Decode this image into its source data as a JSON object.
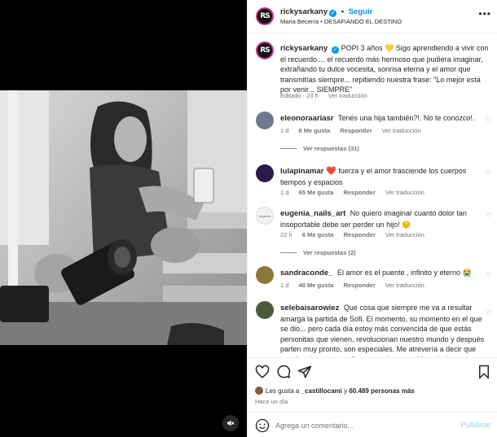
{
  "post": {
    "username": "rickysarkany",
    "follow_label": "Seguir",
    "audio": "Maria Becerra • DESAFIANDO EL DESTINO",
    "avatar_initials": "RS",
    "more_icon": "more-horizontal-icon"
  },
  "caption": {
    "username": "rickysarkany",
    "text": "POPI 3 años 💛 Sigo aprendiendo a vivir con el recuerdo.... el recuerdo más hermoso que pudiera imaginar, extrañando tu dulce vocesita, sonrisa eterna y el amor que transmitías siempre... repitiendo nuestra frase: \"Lo mejor está por venir... SIEMPRE\"",
    "edited": "Editado · 23 h",
    "translate": "Ver traducción"
  },
  "comments": [
    {
      "username": "eleonoraariasr",
      "text": "Tenés una hija también?!. No te conozco!.",
      "time": "1 d",
      "likes": "8 Me gusta",
      "reply": "Responder",
      "translate": "Ver traducción",
      "replies": "Ver respuestas (31)",
      "avatar_color": "#6b7a8f"
    },
    {
      "username": "lulapinamar",
      "heart": "❤️",
      "text": "fuerza y el amor trasciende los cuerpos tiempos y espacios",
      "time": "1 d",
      "likes": "65 Me gusta",
      "reply": "Responder",
      "translate": "Ver traducción",
      "avatar_color": "#2b1b4a"
    },
    {
      "username": "eugenia_nails_art",
      "text": "No quiero imaginar cuanto dolor tan insoportable debe ser perder un hijo! 😔",
      "time": "22 h",
      "likes": "6 Me gusta",
      "reply": "Responder",
      "translate": "Ver traducción",
      "replies": "Ver respuestas (2)",
      "avatar_color": "#f2f2f2",
      "avatar_text": "eugenia"
    },
    {
      "username": "sandraconde_",
      "text": "El amor es el puente , infinito y eterno 😭",
      "time": "1 d",
      "likes": "40 Me gusta",
      "reply": "Responder",
      "translate": "Ver traducción",
      "avatar_color": "#8a7a3a"
    },
    {
      "username": "selebaisarowiez",
      "text": "Que cosa que siempre me va a resultar amarga la partida de Sofi. El momento, su momento en el que se dio... pero cada día estoy más convencida de que estás personitas que vienen, revolucionan nuestro mundo y después parten muy pronto, son especiales. Me atrevería a decir que son ángeles, pero prefiero ser más precavida y decir que son",
      "avatar_color": "#4a5a3a"
    }
  ],
  "footer": {
    "likes_prefix": "Les gusta a",
    "liked_by": "_castillocami",
    "likes_middle": "y",
    "likes_count": "60.489 personas más",
    "time": "Hace un día",
    "comment_placeholder": "Agrega un comentario...",
    "publish": "Publicar"
  },
  "colors": {
    "accent": "#0095f6",
    "publish_disabled": "#b3dbff"
  }
}
